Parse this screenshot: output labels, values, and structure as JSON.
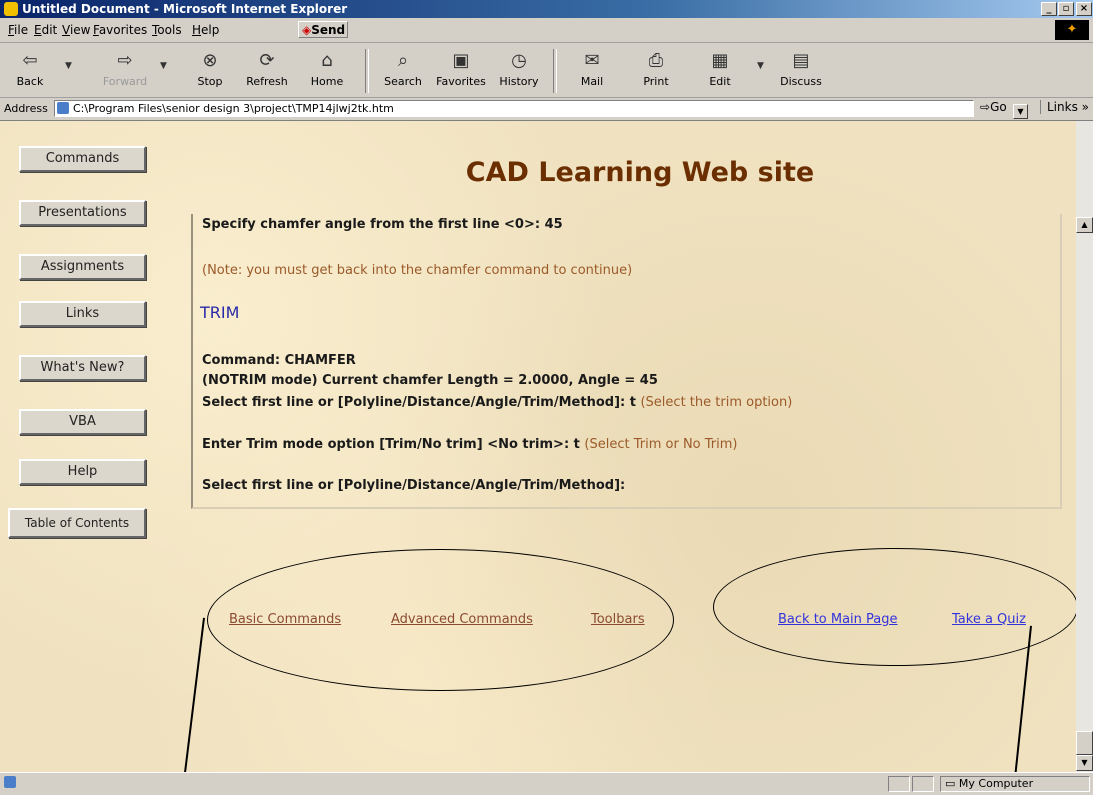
{
  "window": {
    "title": "Untitled Document - Microsoft Internet Explorer",
    "buttons": [
      "_",
      "▫",
      "×"
    ]
  },
  "menu": {
    "items": [
      "File",
      "Edit",
      "View",
      "Favorites",
      "Tools",
      "Help"
    ],
    "send_label": "Send"
  },
  "toolbar": {
    "back": "Back",
    "forward": "Forward",
    "stop": "Stop",
    "refresh": "Refresh",
    "home": "Home",
    "search": "Search",
    "favorites": "Favorites",
    "history": "History",
    "mail": "Mail",
    "print": "Print",
    "edit": "Edit",
    "discuss": "Discuss"
  },
  "address": {
    "label": "Address",
    "value": "C:\\Program Files\\senior design 3\\project\\TMP14jlwj2tk.htm",
    "go": "Go",
    "links": "Links »"
  },
  "nav": {
    "commands": "Commands",
    "presentations": "Presentations",
    "assignments": "Assignments",
    "links": "Links",
    "whats_new": "What's New?",
    "vba": "VBA",
    "help": "Help",
    "toc": "Table of Contents"
  },
  "page": {
    "title": "CAD Learning Web site",
    "line1": "Specify chamfer angle from the first line <0>: 45",
    "note1": "(Note: you must get back into the chamfer command to continue)",
    "section": "TRIM",
    "line2": "Command: CHAMFER",
    "line3": "(NOTRIM mode) Current chamfer Length = 2.0000, Angle = 45",
    "line4": "Select first line or [Polyline/Distance/Angle/Trim/Method]: t",
    "note4": "(Select the trim option)",
    "line5": "Enter Trim mode option [Trim/No trim] <No trim>: t",
    "note5": "(Select Trim or No Trim)",
    "line6": "Select first line or [Polyline/Distance/Angle/Trim/Method]:"
  },
  "bottom_links": {
    "basic": "Basic Commands",
    "advanced": "Advanced Commands",
    "toolbars": "Toolbars",
    "main": "Back to Main Page",
    "quiz": "Take a Quiz"
  },
  "status": {
    "zone": "My Computer"
  },
  "colors": {
    "title_text": "#6a2e00",
    "note": "#9b5a2a",
    "trim": "#2a2aa8",
    "link_visited": "#8a4a30",
    "link": "#3333dd"
  }
}
